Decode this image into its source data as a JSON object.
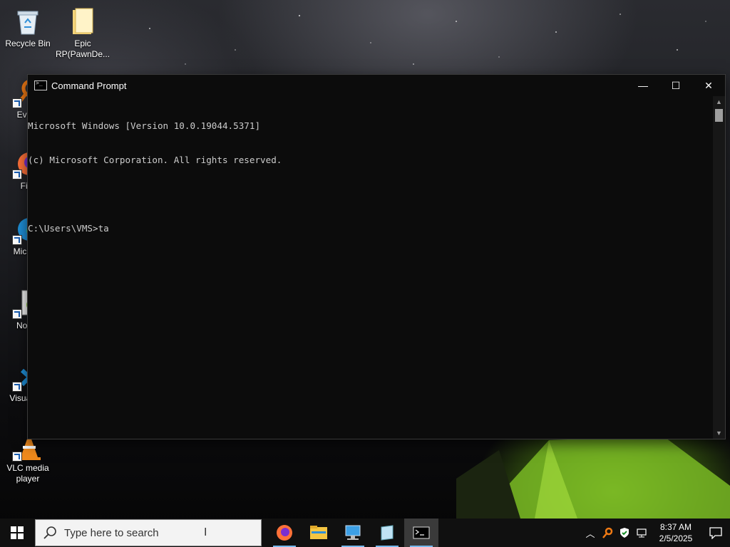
{
  "desktop": {
    "icons": [
      {
        "label": "Recycle Bin",
        "icon": "recycle-bin-icon"
      },
      {
        "label": "Epic RP(PawnDe...",
        "icon": "folder-icon"
      },
      {
        "label": "Every",
        "icon": "everything-search-icon"
      },
      {
        "label": "Fire",
        "icon": "firefox-icon"
      },
      {
        "label": "Micr Ed",
        "icon": "edge-icon"
      },
      {
        "label": "Notep",
        "icon": "notepad-plus-plus-icon"
      },
      {
        "label": "Visual Co",
        "icon": "vscode-icon"
      },
      {
        "label": "VLC media player",
        "icon": "vlc-icon"
      }
    ]
  },
  "window": {
    "title": "Command Prompt",
    "controls": {
      "minimize": "—",
      "maximize": "☐",
      "close": "✕"
    },
    "console_lines": [
      "Microsoft Windows [Version 10.0.19044.5371]",
      "(c) Microsoft Corporation. All rights reserved.",
      "",
      "C:\\Users\\VMS>ta"
    ]
  },
  "taskbar": {
    "search_placeholder": "Type here to search",
    "apps": [
      "firefox-icon",
      "file-explorer-icon",
      "network-icon",
      "notepad-icon",
      "command-prompt-icon"
    ],
    "clock": {
      "time": "8:37 AM",
      "date": "2/5/2025"
    }
  },
  "colors": {
    "console_bg": "#0c0c0c",
    "console_text": "#cccccc",
    "taskbar_bg": "#101010",
    "accent": "#76b9ed"
  }
}
